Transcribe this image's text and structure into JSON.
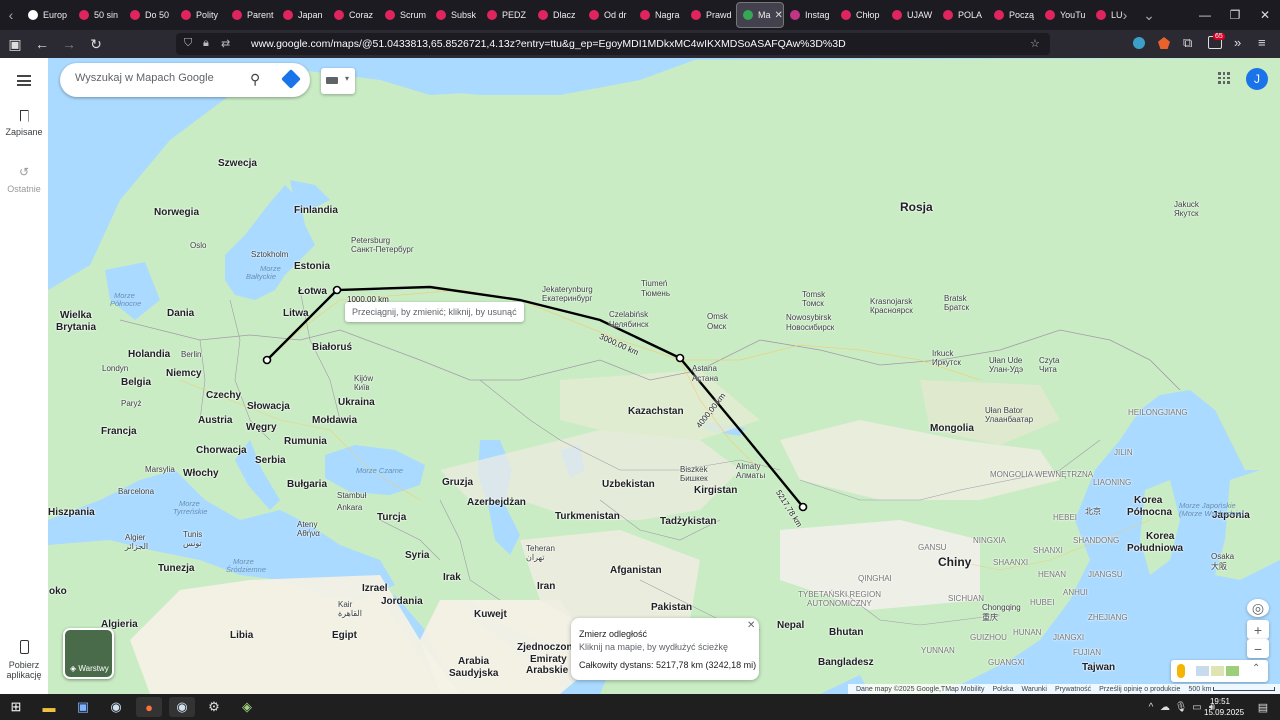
{
  "browser": {
    "tabs": [
      {
        "label": "Europ",
        "color": "#ffffff"
      },
      {
        "label": "50 sin",
        "color": "#e0245e"
      },
      {
        "label": "Do 50",
        "color": "#e0245e"
      },
      {
        "label": "Polity",
        "color": "#e0245e"
      },
      {
        "label": "Parent",
        "color": "#e0245e"
      },
      {
        "label": "Japan",
        "color": "#e0245e"
      },
      {
        "label": "Coraz",
        "color": "#e0245e"
      },
      {
        "label": "Scrum",
        "color": "#e0245e"
      },
      {
        "label": "Subsk",
        "color": "#e0245e"
      },
      {
        "label": "PEDZ",
        "color": "#e0245e"
      },
      {
        "label": "Dlacz",
        "color": "#e0245e"
      },
      {
        "label": "Od dr",
        "color": "#e0245e"
      },
      {
        "label": "Nagra",
        "color": "#e0245e"
      },
      {
        "label": "Prawd",
        "color": "#e0245e"
      },
      {
        "label": "Ma",
        "color": "#34a853",
        "active": true
      },
      {
        "label": "Instag",
        "color": "#c13584"
      },
      {
        "label": "Chłop",
        "color": "#e0245e"
      },
      {
        "label": "UJAW",
        "color": "#e0245e"
      },
      {
        "label": "POLA",
        "color": "#e0245e"
      },
      {
        "label": "Począ",
        "color": "#e0245e"
      },
      {
        "label": "YouTu",
        "color": "#e0245e"
      },
      {
        "label": "LU",
        "color": "#e0245e"
      }
    ],
    "url": "www.google.com/maps/@51.0433813,65.8526721,4.13z?entry=ttu&g_ep=EgoyMDI1MDkxMC4wIKXMDSoASAFQAw%3D%3D",
    "extension_badge": "65"
  },
  "maps": {
    "search_placeholder": "Wyszukaj w Mapach Google",
    "avatar_letter": "J",
    "sidebar": {
      "saved": "Zapisane",
      "recent": "Ostatnie",
      "download_1": "Pobierz",
      "download_2": "aplikację"
    },
    "layers_label": "Warstwy",
    "tooltip": "Przeciągnij, by zmienić; kliknij, by usunąć",
    "measure": {
      "title": "Zmierz odległość",
      "hint": "Kliknij na mapie, by wydłużyć ścieżkę",
      "total": "Całkowity dystans: 5217,78 km (3242,18 mi)"
    },
    "distance_labels": {
      "d1": "1000,00 km",
      "d2": "km",
      "d3": "3000,00 km",
      "d4": "4000,00 km",
      "d5": "5217,78 km"
    },
    "attribution": {
      "data": "Dane mapy ©2025 Google,TMap Mobility",
      "country": "Polska",
      "terms": "Warunki",
      "privacy": "Prywatność",
      "feedback": "Prześlij opinię o produkcie",
      "scale": "500 km"
    },
    "labels": {
      "rosja": "Rosja",
      "kazachstan": "Kazachstan",
      "chiny": "Chiny",
      "mongolia": "Mongolia",
      "finlandia": "Finlandia",
      "szwecja": "Szwecja",
      "norwegia": "Norwegia",
      "estonia": "Estonia",
      "lotwa": "Łotwa",
      "litwa": "Litwa",
      "bialorus": "Białoruś",
      "ukraina": "Ukraina",
      "moldawia": "Mołdawia",
      "rumunia": "Rumunia",
      "wegry": "Węgry",
      "slowacja": "Słowacja",
      "czechy": "Czechy",
      "austria": "Austria",
      "niemcy": "Niemcy",
      "holandia": "Holandia",
      "belgia": "Belgia",
      "dania": "Dania",
      "wielka1": "Wielka",
      "wielka2": "Brytania",
      "francja": "Francja",
      "chorwacja": "Chorwacja",
      "serbia": "Serbia",
      "bulgaria": "Bułgaria",
      "wlochy": "Włochy",
      "hiszpania": "Hiszpania",
      "turcja": "Turcja",
      "gruzja": "Gruzja",
      "azerbejdzan": "Azerbejdżan",
      "turkmenistan": "Turkmenistan",
      "uzbekistan": "Uzbekistan",
      "kirgistan": "Kirgistan",
      "tadzykistan": "Tadżykistan",
      "afganistan": "Afganistan",
      "pakistan": "Pakistan",
      "iran": "Iran",
      "irak": "Irak",
      "syria": "Syria",
      "izrael": "Izrael",
      "jordania": "Jordania",
      "egipt": "Egipt",
      "libia": "Libia",
      "tunezja": "Tunezja",
      "algieria": "Algieria",
      "kuwejt": "Kuwejt",
      "arabia1": "Arabia",
      "arabia2": "Saudyjska",
      "zjedn1": "Zjednoczone",
      "zjedn2": "Emiraty",
      "zjedn3": "Arabskie",
      "nepal": "Nepal",
      "bhutan": "Bhutan",
      "bangladesz": "Bangladesz",
      "tajwan": "Tajwan",
      "korea_p1": "Korea",
      "korea_p2": "Północna",
      "korea_s1": "Korea",
      "korea_s2": "Południowa",
      "japonia": "Japonia",
      "oko": "oko",
      "petersburg1": "Petersburg",
      "petersburg2": "Санкт-Петербург",
      "jekaterynburg1": "Jekaterynburg",
      "jekaterynburg2": "Екатеринбург",
      "tiumen1": "Tiumeń",
      "tiumen2": "Тюмень",
      "czelabinsk1": "Czelabińsk",
      "czelabinsk2": "Челябинск",
      "omsk1": "Omsk",
      "omsk2": "Омск",
      "tomsk1": "Tomsk",
      "tomsk2": "Томск",
      "nowosybirsk1": "Nowosybirsk",
      "nowosybirsk2": "Новосибирск",
      "krasnojarsk1": "Krasnojarsk",
      "krasnojarsk2": "Красноярск",
      "bratsk1": "Bratsk",
      "bratsk2": "Братск",
      "irkuck1": "Irkuck",
      "irkuck2": "Иркутск",
      "ulanude1": "Ułan Ude",
      "ulanude2": "Улан-Удэ",
      "czyta1": "Czyta",
      "czyta2": "Чита",
      "jakuck1": "Jakuck",
      "jakuck2": "Якутск",
      "astana1": "Astana",
      "astana2": "Астана",
      "almaty1": "Almaty",
      "almaty2": "Алматы",
      "biszkek1": "Biszkek",
      "biszkek2": "Бишкек",
      "ulanbator1": "Ułan Bator",
      "ulanbator2": "Улаанбаатар",
      "kijow1": "Kijów",
      "kijow2": "Київ",
      "sztokholm": "Sztokholm",
      "oslo": "Oslo",
      "berlin": "Berlin",
      "londyn": "Londyn",
      "paryz": "Paryż",
      "marsylia": "Marsylia",
      "barcelona": "Barcelona",
      "stambul": "Stambuł",
      "ankara": "Ankara",
      "ateny1": "Ateny",
      "ateny2": "Αθήνα",
      "tunis1": "Tunis",
      "tunis2": "تونس",
      "algier1": "Algier",
      "algier2": "الجزائر",
      "teheran1": "Teheran",
      "teheran2": "تهران",
      "kair1": "Kair",
      "kair2": "القاهرة",
      "pekin": "北京",
      "chongqing1": "Chongqing",
      "chongqing2": "重庆",
      "osaka1": "Osaka",
      "osaka2": "大阪",
      "qinghai": "QINGHAI",
      "tibet1": "TYBETAŃSKI REGION",
      "tibet2": "AUTONOMICZNY",
      "gansu": "GANSU",
      "neimeng": "MONGOLIA WEWNĘTRZNA",
      "sichuan": "SICHUAN",
      "yunnan": "YUNNAN",
      "guangxi": "GUANGXI",
      "hunan": "HUNAN",
      "guizhou": "GUIZHOU",
      "hubei": "HUBEI",
      "henan": "HENAN",
      "shanxi": "SHANXI",
      "ningxia": "NINGXIA",
      "shaanxi": "SHAANXI",
      "shandong": "SHANDONG",
      "jiangxi": "JIANGXI",
      "fujian": "FUJIAN",
      "anhui": "ANHUI",
      "jiangsu": "JIANGSU",
      "zhejiang": "ZHEJIANG",
      "jilin": "JILIN",
      "liaoning": "LIAONING",
      "hebei": "HEBEI",
      "heilong": "HEILONGJIANG",
      "morze_polnocne1": "Morze",
      "morze_polnocne2": "Północne",
      "morze_baltyckie1": "Morze",
      "morze_baltyckie2": "Bałtyckie",
      "morze_czarne": "Morze Czarne",
      "morze_tyrrenskie1": "Morze",
      "morze_tyrrenskie2": "Tyrreńskie",
      "morze_srodziemne1": "Morze",
      "morze_srodziemne2": "Śródziemne",
      "morze_japonskie1": "Morze Japońskie",
      "morze_japonskie2": "(Morze Wschodnie)"
    }
  },
  "taskbar": {
    "time": "19:51",
    "date": "15.09.2025"
  }
}
